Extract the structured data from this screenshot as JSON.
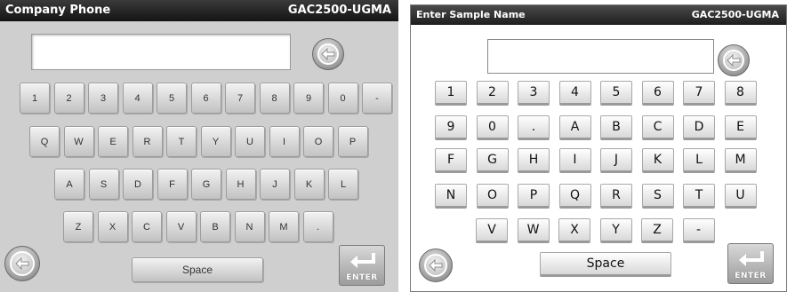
{
  "left": {
    "title": "Company Phone",
    "model": "GAC2500-UGMA",
    "input_value": "",
    "rows": [
      [
        "1",
        "2",
        "3",
        "4",
        "5",
        "6",
        "7",
        "8",
        "9",
        "0",
        "-"
      ],
      [
        "Q",
        "W",
        "E",
        "R",
        "T",
        "Y",
        "U",
        "I",
        "O",
        "P"
      ],
      [
        "A",
        "S",
        "D",
        "F",
        "G",
        "H",
        "J",
        "K",
        "L"
      ],
      [
        "Z",
        "X",
        "C",
        "V",
        "B",
        "N",
        "M",
        "."
      ]
    ],
    "space_label": "Space",
    "enter_label": "ENTER"
  },
  "right": {
    "title": "Enter Sample Name",
    "model": "GAC2500-UGMA",
    "input_value": "",
    "rows": [
      [
        "1",
        "2",
        "3",
        "4",
        "5",
        "6",
        "7",
        "8"
      ],
      [
        "9",
        "0",
        ".",
        "A",
        "B",
        "C",
        "D",
        "E"
      ],
      [
        "F",
        "G",
        "H",
        "I",
        "J",
        "K",
        "L",
        "M"
      ],
      [
        "N",
        "O",
        "P",
        "Q",
        "R",
        "S",
        "T",
        "U"
      ],
      [
        "V",
        "W",
        "X",
        "Y",
        "Z",
        "-"
      ]
    ],
    "space_label": "Space",
    "enter_label": "ENTER"
  },
  "icons": {
    "backspace": "arrow-left-icon",
    "back": "arrow-left-icon",
    "enter": "enter-return-icon"
  }
}
